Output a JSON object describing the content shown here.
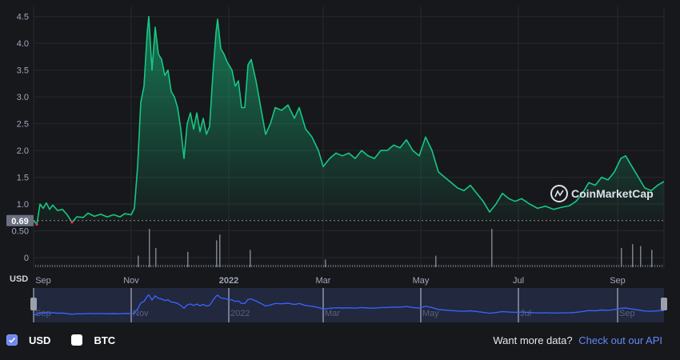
{
  "chart_data": {
    "type": "area",
    "y_unit": "USD",
    "ylim": [
      0,
      4.6
    ],
    "y_ticks": [
      "0",
      "0.50",
      "1.0",
      "1.5",
      "2.0",
      "2.5",
      "3.0",
      "3.5",
      "4.0",
      "4.5"
    ],
    "x_range": [
      "2021-09-01",
      "2022-09-30"
    ],
    "x_ticks": [
      {
        "label": "Sep",
        "date": "2021-09-01"
      },
      {
        "label": "Nov",
        "date": "2021-11-01"
      },
      {
        "label": "2022",
        "date": "2022-01-01"
      },
      {
        "label": "Mar",
        "date": "2022-03-01"
      },
      {
        "label": "May",
        "date": "2022-05-01"
      },
      {
        "label": "Jul",
        "date": "2022-07-01"
      },
      {
        "label": "Sep",
        "date": "2022-09-01"
      }
    ],
    "open_price_label": "0.69",
    "open_price": 0.69,
    "grid": true,
    "series": [
      {
        "values": [
          [
            "2021-09-01",
            0.69
          ],
          [
            "2021-09-03",
            0.62
          ],
          [
            "2021-09-05",
            1.0
          ],
          [
            "2021-09-07",
            0.92
          ],
          [
            "2021-09-09",
            1.02
          ],
          [
            "2021-09-11",
            0.9
          ],
          [
            "2021-09-13",
            0.98
          ],
          [
            "2021-09-16",
            0.88
          ],
          [
            "2021-09-19",
            0.9
          ],
          [
            "2021-09-22",
            0.8
          ],
          [
            "2021-09-25",
            0.66
          ],
          [
            "2021-09-28",
            0.76
          ],
          [
            "2021-10-02",
            0.75
          ],
          [
            "2021-10-05",
            0.83
          ],
          [
            "2021-10-09",
            0.77
          ],
          [
            "2021-10-13",
            0.81
          ],
          [
            "2021-10-17",
            0.76
          ],
          [
            "2021-10-21",
            0.8
          ],
          [
            "2021-10-25",
            0.76
          ],
          [
            "2021-10-28",
            0.82
          ],
          [
            "2021-11-01",
            0.8
          ],
          [
            "2021-11-03",
            0.92
          ],
          [
            "2021-11-05",
            1.7
          ],
          [
            "2021-11-07",
            2.9
          ],
          [
            "2021-11-09",
            3.2
          ],
          [
            "2021-11-11",
            4.2
          ],
          [
            "2021-11-12",
            4.5
          ],
          [
            "2021-11-14",
            3.5
          ],
          [
            "2021-11-16",
            4.3
          ],
          [
            "2021-11-18",
            3.8
          ],
          [
            "2021-11-20",
            3.7
          ],
          [
            "2021-11-22",
            3.4
          ],
          [
            "2021-11-24",
            3.5
          ],
          [
            "2021-11-26",
            3.1
          ],
          [
            "2021-11-28",
            3.0
          ],
          [
            "2021-11-30",
            2.8
          ],
          [
            "2021-12-02",
            2.4
          ],
          [
            "2021-12-04",
            1.85
          ],
          [
            "2021-12-06",
            2.5
          ],
          [
            "2021-12-08",
            2.7
          ],
          [
            "2021-12-10",
            2.4
          ],
          [
            "2021-12-12",
            2.7
          ],
          [
            "2021-12-14",
            2.35
          ],
          [
            "2021-12-16",
            2.6
          ],
          [
            "2021-12-18",
            2.3
          ],
          [
            "2021-12-20",
            2.45
          ],
          [
            "2021-12-22",
            3.4
          ],
          [
            "2021-12-24",
            4.2
          ],
          [
            "2021-12-25",
            4.45
          ],
          [
            "2021-12-27",
            3.9
          ],
          [
            "2021-12-29",
            3.8
          ],
          [
            "2021-12-31",
            3.65
          ],
          [
            "2022-01-03",
            3.5
          ],
          [
            "2022-01-05",
            3.2
          ],
          [
            "2022-01-07",
            3.3
          ],
          [
            "2022-01-09",
            2.8
          ],
          [
            "2022-01-11",
            2.8
          ],
          [
            "2022-01-13",
            3.6
          ],
          [
            "2022-01-15",
            3.7
          ],
          [
            "2022-01-18",
            3.3
          ],
          [
            "2022-01-21",
            2.8
          ],
          [
            "2022-01-24",
            2.3
          ],
          [
            "2022-01-27",
            2.5
          ],
          [
            "2022-01-30",
            2.8
          ],
          [
            "2022-02-03",
            2.75
          ],
          [
            "2022-02-07",
            2.85
          ],
          [
            "2022-02-11",
            2.6
          ],
          [
            "2022-02-14",
            2.8
          ],
          [
            "2022-02-18",
            2.4
          ],
          [
            "2022-02-22",
            2.25
          ],
          [
            "2022-02-26",
            2.0
          ],
          [
            "2022-03-01",
            1.7
          ],
          [
            "2022-03-05",
            1.85
          ],
          [
            "2022-03-09",
            1.95
          ],
          [
            "2022-03-13",
            1.9
          ],
          [
            "2022-03-17",
            1.95
          ],
          [
            "2022-03-21",
            1.85
          ],
          [
            "2022-03-25",
            2.0
          ],
          [
            "2022-03-29",
            1.9
          ],
          [
            "2022-04-02",
            1.85
          ],
          [
            "2022-04-06",
            2.0
          ],
          [
            "2022-04-10",
            2.0
          ],
          [
            "2022-04-14",
            2.1
          ],
          [
            "2022-04-18",
            2.05
          ],
          [
            "2022-04-22",
            2.2
          ],
          [
            "2022-04-26",
            2.0
          ],
          [
            "2022-04-30",
            1.9
          ],
          [
            "2022-05-04",
            2.25
          ],
          [
            "2022-05-08",
            2.0
          ],
          [
            "2022-05-12",
            1.6
          ],
          [
            "2022-05-16",
            1.5
          ],
          [
            "2022-05-20",
            1.4
          ],
          [
            "2022-05-24",
            1.3
          ],
          [
            "2022-05-28",
            1.25
          ],
          [
            "2022-06-01",
            1.35
          ],
          [
            "2022-06-05",
            1.2
          ],
          [
            "2022-06-09",
            1.05
          ],
          [
            "2022-06-13",
            0.85
          ],
          [
            "2022-06-17",
            1.0
          ],
          [
            "2022-06-21",
            1.2
          ],
          [
            "2022-06-25",
            1.1
          ],
          [
            "2022-06-29",
            1.05
          ],
          [
            "2022-07-03",
            1.1
          ],
          [
            "2022-07-08",
            1.0
          ],
          [
            "2022-07-13",
            0.92
          ],
          [
            "2022-07-18",
            0.96
          ],
          [
            "2022-07-23",
            0.9
          ],
          [
            "2022-07-28",
            0.94
          ],
          [
            "2022-08-02",
            0.97
          ],
          [
            "2022-08-06",
            1.05
          ],
          [
            "2022-08-10",
            1.2
          ],
          [
            "2022-08-14",
            1.4
          ],
          [
            "2022-08-18",
            1.35
          ],
          [
            "2022-08-22",
            1.5
          ],
          [
            "2022-08-26",
            1.45
          ],
          [
            "2022-08-30",
            1.6
          ],
          [
            "2022-09-03",
            1.85
          ],
          [
            "2022-09-06",
            1.9
          ],
          [
            "2022-09-10",
            1.7
          ],
          [
            "2022-09-14",
            1.5
          ],
          [
            "2022-09-18",
            1.3
          ],
          [
            "2022-09-22",
            1.25
          ],
          [
            "2022-09-26",
            1.35
          ],
          [
            "2022-09-30",
            1.42
          ]
        ]
      }
    ],
    "volume": {
      "unit": "relative",
      "values": [
        [
          "2021-11-05",
          0.3
        ],
        [
          "2021-11-12",
          1.0
        ],
        [
          "2021-11-16",
          0.5
        ],
        [
          "2021-12-06",
          0.4
        ],
        [
          "2021-12-24",
          0.7
        ],
        [
          "2021-12-26",
          0.85
        ],
        [
          "2022-01-14",
          0.45
        ],
        [
          "2022-03-02",
          0.2
        ],
        [
          "2022-05-10",
          0.3
        ],
        [
          "2022-06-14",
          1.6
        ],
        [
          "2022-09-03",
          0.5
        ],
        [
          "2022-09-10",
          0.6
        ],
        [
          "2022-09-15",
          0.55
        ],
        [
          "2022-09-22",
          0.45
        ]
      ]
    },
    "colors": {
      "line_up": "#16c784",
      "line_down": "#ea3943",
      "navigator_line": "#3861fb",
      "grid": "#26282d"
    }
  },
  "legend": {
    "usd_label": "USD",
    "usd_checked": true,
    "btc_label": "BTC",
    "btc_checked": false
  },
  "watermark": "CoinMarketCap",
  "api_prompt": "Want more data?",
  "api_link": "Check out our API",
  "axis_unit_label": "USD"
}
